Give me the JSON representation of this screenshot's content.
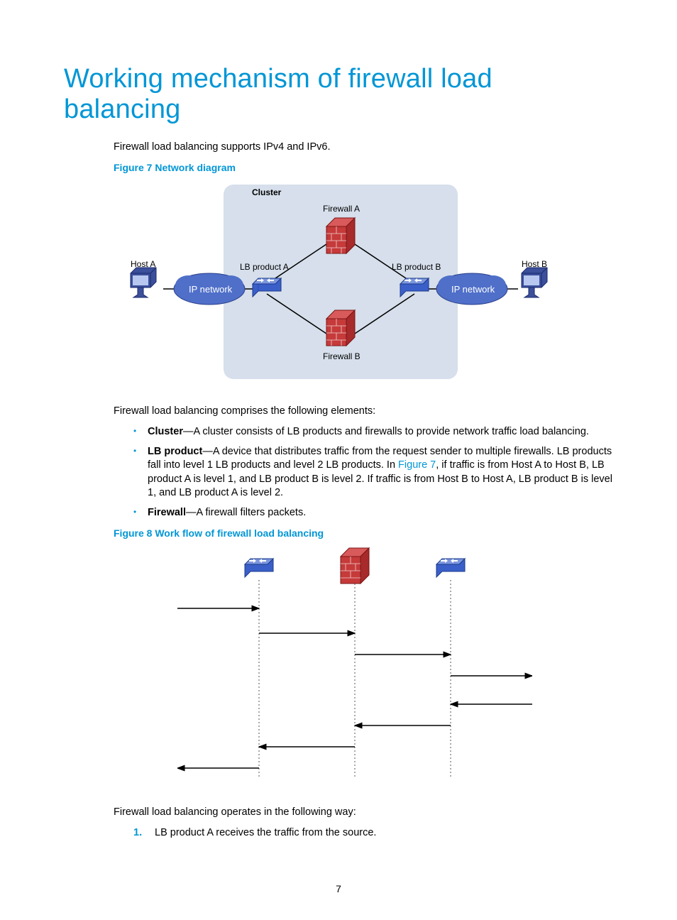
{
  "title": "Working mechanism of firewall load balancing",
  "intro": "Firewall load balancing supports IPv4 and IPv6.",
  "fig7_caption": "Figure 7 Network diagram",
  "fig7": {
    "cluster": "Cluster",
    "firewall_a": "Firewall A",
    "firewall_b": "Firewall B",
    "lb_a": "LB product A",
    "lb_b": "LB product B",
    "host_a": "Host A",
    "host_b": "Host B",
    "ip_network": "IP network"
  },
  "elements_intro": "Firewall load balancing comprises the following elements:",
  "items": {
    "cluster_term": "Cluster",
    "cluster_desc": "—A cluster consists of LB products and firewalls to provide network traffic load balancing.",
    "lb_term": "LB product",
    "lb_desc_a": "—A device that distributes traffic from the request sender to multiple firewalls. LB products fall into level 1 LB products and level 2 LB products. In ",
    "lb_link": "Figure 7",
    "lb_desc_b": ", if traffic is from Host A to Host B, LB product A is level 1, and LB product B is level 2. If traffic is from Host B to Host A, LB product B is level 1, and LB product A is level 2.",
    "fw_term": "Firewall",
    "fw_desc": "—A firewall filters packets."
  },
  "fig8_caption": "Figure 8 Work flow of firewall load balancing",
  "operates_intro": "Firewall load balancing operates in the following way:",
  "steps": {
    "s1": "LB product A receives the traffic from the source."
  },
  "page_number": "7"
}
